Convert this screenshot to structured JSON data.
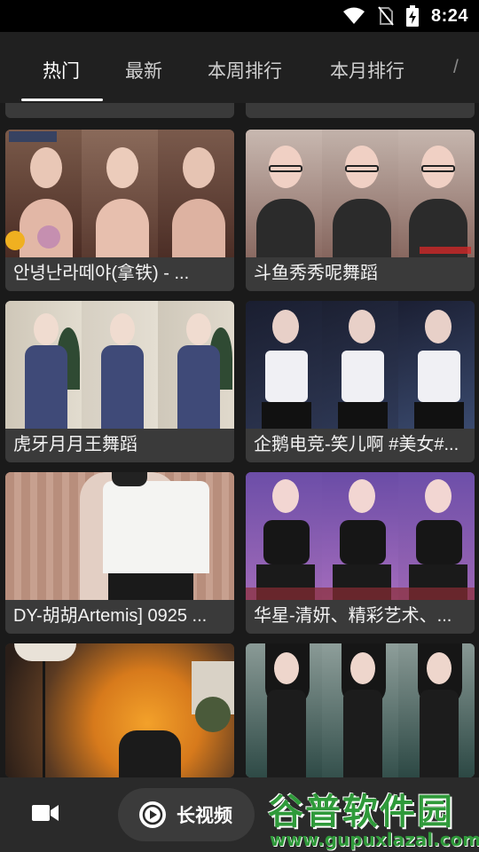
{
  "status_bar": {
    "time": "8:24",
    "icons": [
      "wifi-icon",
      "no-sim-icon",
      "battery-charging-icon"
    ]
  },
  "tabs": [
    {
      "label": "热门",
      "active": true
    },
    {
      "label": "最新",
      "active": false
    },
    {
      "label": "本周排行",
      "active": false
    },
    {
      "label": "本月排行",
      "active": false
    }
  ],
  "feed": {
    "cards": [
      {
        "title": "안녕난라떼야(拿铁) - ..."
      },
      {
        "title": "斗鱼秀秀呢舞蹈"
      },
      {
        "title": "虎牙月月王舞蹈"
      },
      {
        "title": "企鹅电竞-笑儿啊 #美女#..."
      },
      {
        "title": "DY-胡胡Artemis] 0925 ..."
      },
      {
        "title": "华星-清妍、精彩艺术、..."
      }
    ]
  },
  "bottom_nav": {
    "video_icon": "video-camera-icon",
    "long_video_label": "长视频",
    "play_icon": "play-circle-icon"
  },
  "watermark": {
    "brand": "谷普软件园",
    "url": "www.gupuxlazal.com"
  }
}
